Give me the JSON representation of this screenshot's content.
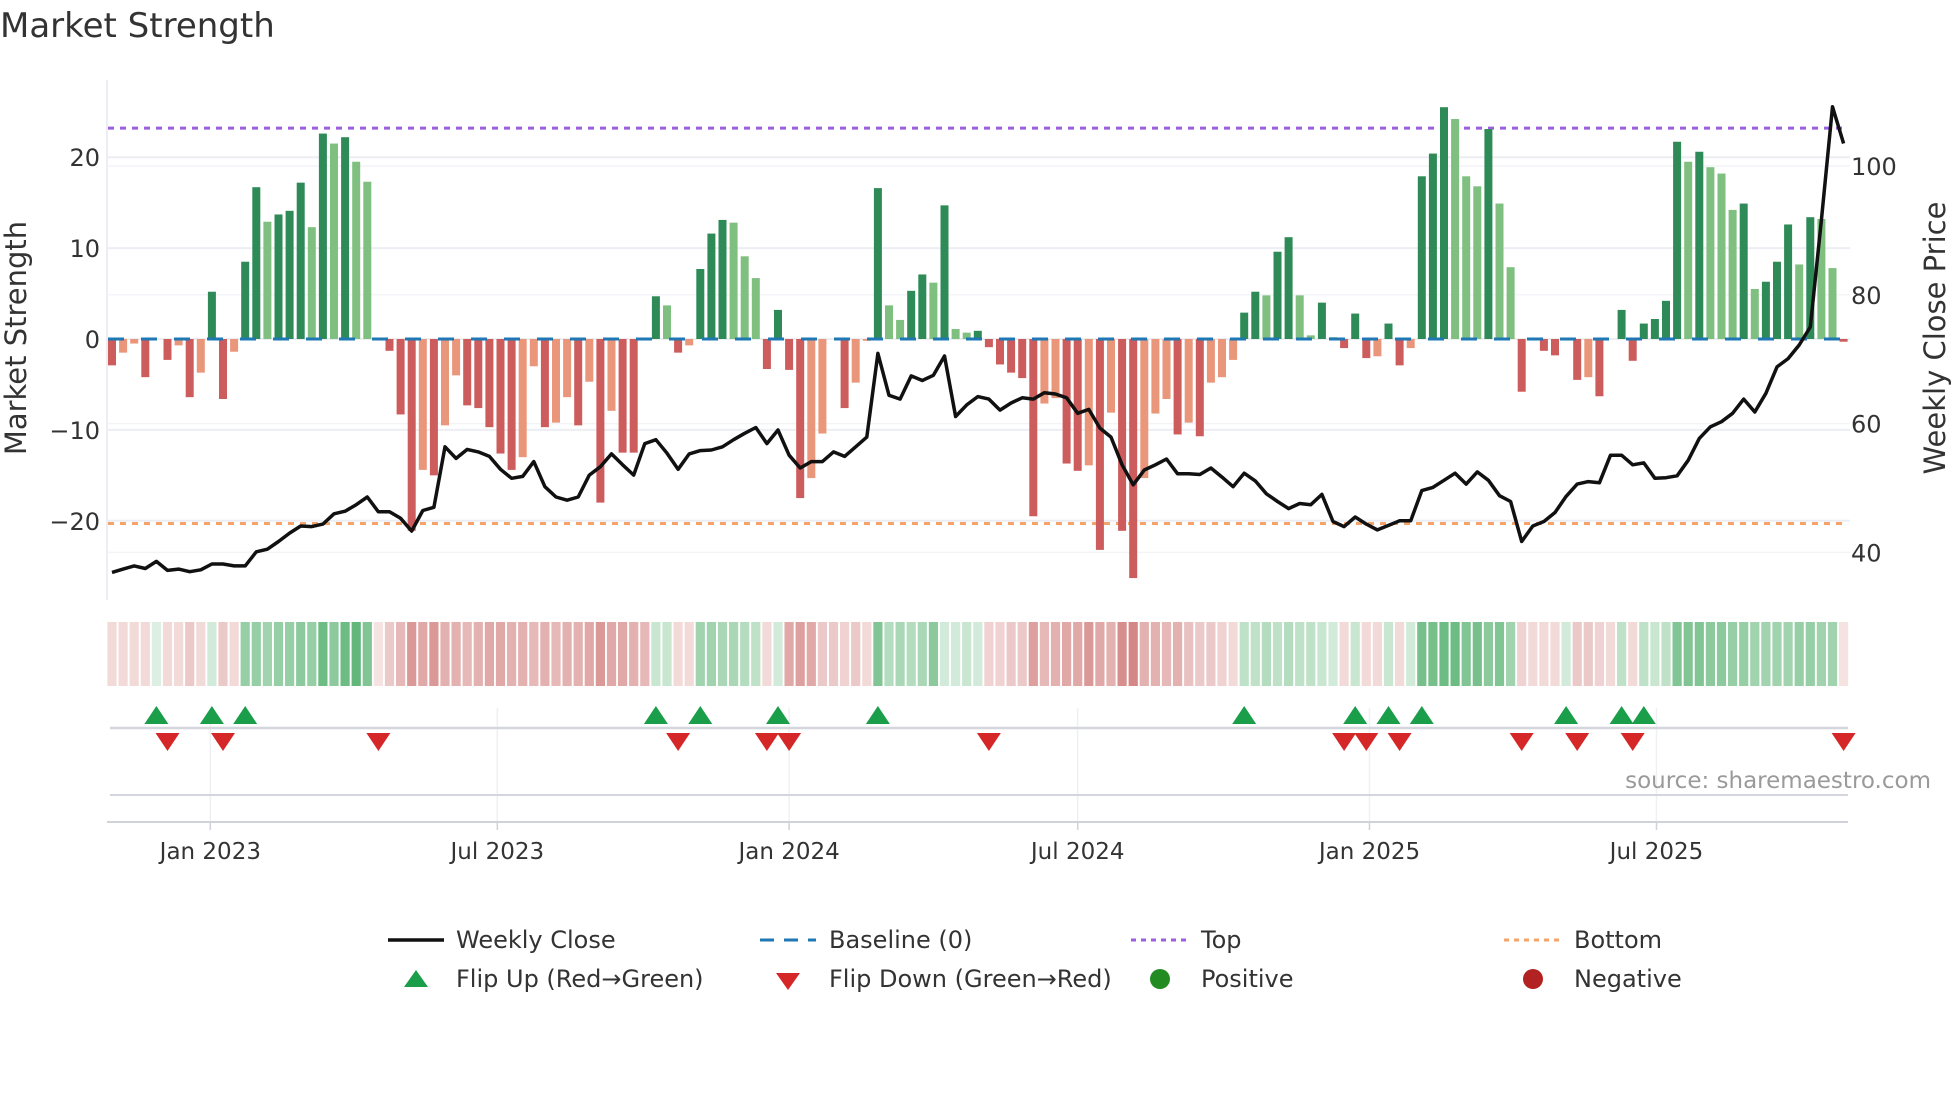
{
  "title": "Market Strength",
  "source": "source: sharemaestro.com",
  "legend": {
    "weekly_close": "Weekly Close",
    "baseline": "Baseline (0)",
    "top": "Top",
    "bottom": "Bottom",
    "flip_up": "Flip Up (Red→Green)",
    "flip_down": "Flip Down (Green→Red)",
    "positive": "Positive",
    "negative": "Negative"
  },
  "colors": {
    "close": "#111111",
    "baseline": "#1f77b4",
    "top": "#9b5fe0",
    "bottom": "#f2a46a",
    "pos_dark": "#2e8b57",
    "pos_light": "#7fbf7f",
    "neg_dark": "#cd5c5c",
    "neg_light": "#e9967a",
    "flip_up": "#1a9e4a",
    "flip_down": "#d62728",
    "positive": "#228b22",
    "negative": "#b22222",
    "strip_green": "#2a9d4a",
    "strip_red": "#c0504d",
    "grid": "#eceef4"
  },
  "chart_data": {
    "type": "bar",
    "title": "Market Strength",
    "ylabel": "Market Strength",
    "y2label": "Weekly Close Price",
    "ylim": [
      -28,
      28.5
    ],
    "y2lim": [
      33,
      118
    ],
    "start_week": "2022-10-31",
    "interval_days": 7,
    "y_ticks": [
      {
        "value": 20,
        "label": "20"
      },
      {
        "value": 10,
        "label": "10"
      },
      {
        "value": 0,
        "label": "0"
      },
      {
        "value": -10,
        "label": "−10"
      },
      {
        "value": -20,
        "label": "−20"
      }
    ],
    "y2_ticks": [
      {
        "value": 100,
        "label": "100"
      },
      {
        "value": 80,
        "label": "80"
      },
      {
        "value": 60,
        "label": "60"
      },
      {
        "value": 40,
        "label": "40"
      }
    ],
    "x_ticks": [
      {
        "date": "2023-01-01",
        "label": "Jan 2023"
      },
      {
        "date": "2023-07-01",
        "label": "Jul 2023"
      },
      {
        "date": "2024-01-01",
        "label": "Jan 2024"
      },
      {
        "date": "2024-07-01",
        "label": "Jul 2024"
      },
      {
        "date": "2025-01-01",
        "label": "Jan 2025"
      },
      {
        "date": "2025-07-01",
        "label": "Jul 2025"
      }
    ],
    "top_level": 23.2,
    "bottom_level": -20.3,
    "baseline": 0,
    "strength": [
      -2.9,
      -1.5,
      -0.5,
      -4.2,
      0,
      -2.3,
      -0.7,
      -6.4,
      -3.7,
      5.2,
      -6.6,
      -1.4,
      8.5,
      16.7,
      12.9,
      13.7,
      14.1,
      17.2,
      12.3,
      22.6,
      21.5,
      22.2,
      19.5,
      17.3,
      0,
      -1.3,
      -8.3,
      -21.1,
      -14.4,
      -15,
      -9.5,
      -4,
      -7.3,
      -7.6,
      -9.7,
      -12.6,
      -14.4,
      -13,
      -3,
      -9.7,
      -9.2,
      -6.4,
      -9.5,
      -4.7,
      -18,
      -7.9,
      -12.5,
      -12.5,
      -0.1,
      4.7,
      3.7,
      -1.5,
      -0.7,
      7.7,
      11.6,
      13.1,
      12.8,
      9.1,
      6.7,
      -3.3,
      3.2,
      -3.4,
      -17.5,
      -15.3,
      -10.4,
      0,
      -7.6,
      -4.8,
      -0.2,
      16.6,
      3.7,
      2.1,
      5.3,
      7.1,
      6.2,
      14.7,
      1.1,
      0.7,
      0.9,
      -0.9,
      -2.8,
      -3.7,
      -4.3,
      -19.5,
      -7.1,
      -6.5,
      -13.7,
      -14.5,
      -13.9,
      -23.2,
      -8.1,
      -21.1,
      -26.3,
      -15.3,
      -8.2,
      -6.6,
      -10.5,
      -9.2,
      -10.7,
      -4.8,
      -4.2,
      -2.3,
      2.9,
      5.2,
      4.8,
      9.6,
      11.2,
      4.8,
      0.4,
      4.0,
      0.2,
      -1.0,
      2.8,
      -2.1,
      -1.9,
      1.7,
      -2.9,
      -1.0,
      17.9,
      20.4,
      25.5,
      24.2,
      17.9,
      16.8,
      23.1,
      14.9,
      7.9,
      -5.8,
      0,
      -1.3,
      -1.8,
      0,
      -4.5,
      -4.2,
      -6.3,
      0,
      3.2,
      -2.4,
      1.7,
      2.2,
      4.2,
      21.7,
      19.5,
      20.6,
      18.9,
      18.2,
      14.2,
      14.9,
      5.5,
      6.3,
      8.5,
      12.6,
      8.2,
      13.4,
      13.2,
      7.8,
      -0.3
    ],
    "weekly_close": [
      36.9,
      37.4,
      37.9,
      37.5,
      38.6,
      37.2,
      37.4,
      37.0,
      37.3,
      38.2,
      38.2,
      37.9,
      37.9,
      40.1,
      40.5,
      41.7,
      43.0,
      44.1,
      44.0,
      44.4,
      46.0,
      46.4,
      47.4,
      48.6,
      46.3,
      46.3,
      45.3,
      43.3,
      46.5,
      47.0,
      56.4,
      54.6,
      56.0,
      55.6,
      54.9,
      52.9,
      51.5,
      51.8,
      54.1,
      50.2,
      48.6,
      48.1,
      48.6,
      52.0,
      53.3,
      55.3,
      53.6,
      52.0,
      56.9,
      57.5,
      55.4,
      52.9,
      55.3,
      55.8,
      55.9,
      56.4,
      57.5,
      58.5,
      59.4,
      56.9,
      59.0,
      55.1,
      53.1,
      54.1,
      54.1,
      55.6,
      54.9,
      56.4,
      57.9,
      70.9,
      64.4,
      63.8,
      67.4,
      66.7,
      67.5,
      70.5,
      61.1,
      62.9,
      64.2,
      63.8,
      62.1,
      63.2,
      64.0,
      63.8,
      64.8,
      64.6,
      64.0,
      61.6,
      62.2,
      59.3,
      57.9,
      53.6,
      50.5,
      52.8,
      53.6,
      54.5,
      52.2,
      52.2,
      52.1,
      53.1,
      51.7,
      50.2,
      52.3,
      51.1,
      49.1,
      47.9,
      46.8,
      47.6,
      47.4,
      49.0,
      44.8,
      44.0,
      45.5,
      44.4,
      43.5,
      44.2,
      44.9,
      44.9,
      49.6,
      50.1,
      51.2,
      52.3,
      50.6,
      52.5,
      51.2,
      48.8,
      47.9,
      41.7,
      44.1,
      44.8,
      46.2,
      48.7,
      50.6,
      51.0,
      50.8,
      55.1,
      55.1,
      53.6,
      53.9,
      51.5,
      51.6,
      51.9,
      54.3,
      57.7,
      59.5,
      60.3,
      61.6,
      63.8,
      61.8,
      64.7,
      68.8,
      70.1,
      72.2,
      75.0,
      91.6,
      109.2,
      103.5
    ],
    "regime_strip": [
      -0.2,
      -0.2,
      -0.2,
      -0.2,
      0.15,
      -0.2,
      -0.2,
      -0.3,
      -0.2,
      0.2,
      -0.3,
      -0.2,
      0.5,
      0.5,
      0.45,
      0.5,
      0.5,
      0.55,
      0.5,
      0.7,
      0.55,
      0.7,
      0.75,
      0.6,
      -0.15,
      -0.3,
      -0.4,
      -0.6,
      -0.5,
      -0.6,
      -0.45,
      -0.45,
      -0.4,
      -0.45,
      -0.5,
      -0.5,
      -0.45,
      -0.45,
      -0.4,
      -0.45,
      -0.4,
      -0.45,
      -0.45,
      -0.5,
      -0.6,
      -0.5,
      -0.5,
      -0.45,
      -0.4,
      0.25,
      0.25,
      -0.2,
      -0.2,
      0.45,
      0.45,
      0.4,
      0.4,
      0.35,
      0.3,
      -0.2,
      0.2,
      -0.5,
      -0.55,
      -0.5,
      -0.3,
      -0.3,
      -0.25,
      -0.3,
      -0.2,
      0.6,
      0.35,
      0.4,
      0.35,
      0.4,
      0.55,
      0.2,
      0.2,
      0.25,
      0.2,
      -0.25,
      -0.25,
      -0.3,
      -0.3,
      -0.55,
      -0.4,
      -0.45,
      -0.5,
      -0.5,
      -0.6,
      -0.5,
      -0.45,
      -0.65,
      -0.7,
      -0.45,
      -0.45,
      -0.4,
      -0.45,
      -0.35,
      -0.3,
      -0.3,
      -0.25,
      -0.2,
      0.3,
      0.3,
      0.35,
      0.3,
      0.35,
      0.3,
      0.3,
      0.25,
      0.2,
      -0.2,
      0.25,
      -0.2,
      -0.2,
      0.25,
      -0.2,
      0.2,
      0.65,
      0.65,
      0.7,
      0.7,
      0.6,
      0.65,
      0.55,
      0.6,
      0.45,
      -0.25,
      -0.2,
      -0.2,
      -0.2,
      0.2,
      -0.3,
      -0.3,
      -0.25,
      -0.2,
      0.3,
      -0.2,
      0.3,
      0.25,
      0.3,
      0.6,
      0.6,
      0.6,
      0.55,
      0.55,
      0.5,
      0.5,
      0.45,
      0.45,
      0.45,
      0.45,
      0.5,
      0.5,
      0.45,
      0.45,
      -0.15
    ],
    "flip_up_weeks": [
      5,
      10,
      13,
      50,
      54,
      61,
      70,
      103,
      113,
      116,
      119,
      132,
      137,
      139
    ],
    "flip_down_weeks": [
      6,
      11,
      25,
      52,
      60,
      62,
      80,
      112,
      114,
      117,
      128,
      133,
      138,
      157
    ],
    "legend_position": "bottom"
  }
}
